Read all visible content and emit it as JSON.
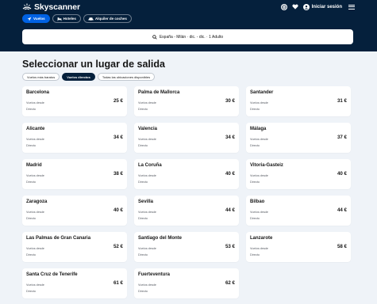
{
  "header": {
    "brand": "Skyscanner",
    "login_label": "Iniciar sesión",
    "tabs": [
      {
        "label": "Vuelos",
        "icon": "plane-icon"
      },
      {
        "label": "Hoteles",
        "icon": "bed-icon"
      },
      {
        "label": "Alquiler de coches",
        "icon": "car-icon"
      }
    ],
    "search_summary": "España - Milán · dic. - dic. · 1 Adulto"
  },
  "page": {
    "title": "Seleccionar un lugar de salida",
    "filters": [
      {
        "label": "Vuelos más baratos",
        "active": false
      },
      {
        "label": "Vuelos directos",
        "active": true
      },
      {
        "label": "Todas las ubicaciones disponibles",
        "active": false
      }
    ]
  },
  "cards": [
    {
      "city": "Barcelona",
      "from": "Vuelos desde",
      "price": "25 €",
      "type": "Directo"
    },
    {
      "city": "Palma de Mallorca",
      "from": "Vuelos desde",
      "price": "30 €",
      "type": "Directo"
    },
    {
      "city": "Santander",
      "from": "Vuelos desde",
      "price": "31 €",
      "type": "Directo"
    },
    {
      "city": "Alicante",
      "from": "Vuelos desde",
      "price": "34 €",
      "type": "Directo"
    },
    {
      "city": "Valencia",
      "from": "Vuelos desde",
      "price": "34 €",
      "type": "Directo"
    },
    {
      "city": "Málaga",
      "from": "Vuelos desde",
      "price": "37 €",
      "type": "Directo"
    },
    {
      "city": "Madrid",
      "from": "Vuelos desde",
      "price": "38 €",
      "type": "Directo"
    },
    {
      "city": "La Coruña",
      "from": "Vuelos desde",
      "price": "40 €",
      "type": "Directo"
    },
    {
      "city": "Vitoria-Gasteiz",
      "from": "Vuelos desde",
      "price": "40 €",
      "type": "Directo"
    },
    {
      "city": "Zaragoza",
      "from": "Vuelos desde",
      "price": "40 €",
      "type": "Directo"
    },
    {
      "city": "Sevilla",
      "from": "Vuelos desde",
      "price": "44 €",
      "type": "Directo"
    },
    {
      "city": "Bilbao",
      "from": "Vuelos desde",
      "price": "44 €",
      "type": "Directo"
    },
    {
      "city": "Las Palmas de Gran Canaria",
      "from": "Vuelos desde",
      "price": "52 €",
      "type": "Directo"
    },
    {
      "city": "Santiago del Monte",
      "from": "Vuelos desde",
      "price": "53 €",
      "type": "Directo"
    },
    {
      "city": "Lanzarote",
      "from": "Vuelos desde",
      "price": "58 €",
      "type": "Directo"
    },
    {
      "city": "Santa Cruz de Tenerife",
      "from": "Vuelos desde",
      "price": "61 €",
      "type": "Directo"
    },
    {
      "city": "Fuerteventura",
      "from": "Vuelos desde",
      "price": "62 €",
      "type": "Directo"
    }
  ],
  "colors": {
    "header_bg": "#05203c",
    "accent": "#0062e3",
    "page_bg": "#eff3f8"
  }
}
